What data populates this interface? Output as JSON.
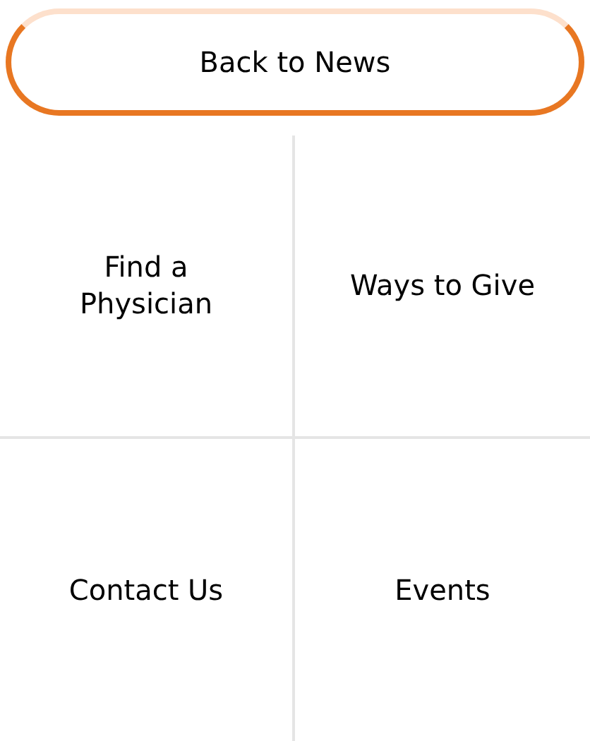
{
  "back_button": {
    "label": "Back to News"
  },
  "links": [
    {
      "label": "Find a\nPhysician"
    },
    {
      "label": "Ways to Give"
    },
    {
      "label": "Contact Us"
    },
    {
      "label": "Events"
    }
  ]
}
